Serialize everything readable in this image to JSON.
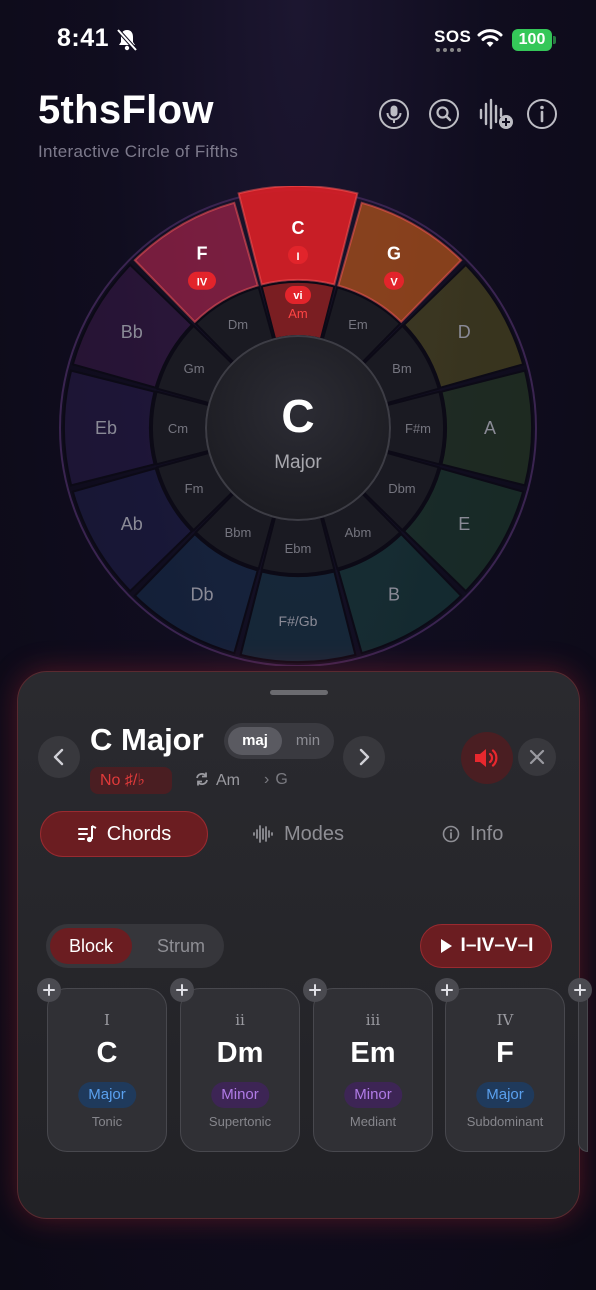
{
  "status": {
    "time": "8:41",
    "sos": "SOS",
    "battery": "100"
  },
  "header": {
    "title": "5thsFlow",
    "subtitle": "Interactive Circle of Fifths"
  },
  "wheel": {
    "center_key": "C",
    "center_mode": "Major",
    "major_keys": [
      "C",
      "G",
      "D",
      "A",
      "E",
      "B",
      "F#/Gb",
      "Db",
      "Ab",
      "Eb",
      "Bb",
      "F"
    ],
    "minor_keys": [
      "Am",
      "Em",
      "Bm",
      "F#m",
      "Dbm",
      "Abm",
      "Ebm",
      "Bbm",
      "Fm",
      "Cm",
      "Gm",
      "Dm"
    ],
    "numerals": {
      "C": "I",
      "G": "V",
      "F": "IV",
      "Am": "vi"
    },
    "segment_colors": [
      "#d21f26",
      "#b8561a",
      "#8f8a1f",
      "#3e6a2a",
      "#2a6a3a",
      "#1f6a55",
      "#1f5a66",
      "#1f4a70",
      "#2a2f6a",
      "#3a276a",
      "#5a2466",
      "#a3244a"
    ]
  },
  "panel": {
    "key_title": "C Major",
    "mode_major": "maj",
    "mode_minor": "min",
    "accidentals": "No ♯/♭",
    "relative": "Am",
    "next_key": "G",
    "tabs": {
      "chords": "Chords",
      "modes": "Modes",
      "info": "Info"
    },
    "playback": {
      "block": "Block",
      "strum": "Strum",
      "progression": "I–IV–V–I"
    },
    "chords": [
      {
        "roman": "I",
        "name": "C",
        "quality": "Major",
        "function": "Tonic"
      },
      {
        "roman": "ii",
        "name": "Dm",
        "quality": "Minor",
        "function": "Supertonic"
      },
      {
        "roman": "iii",
        "name": "Em",
        "quality": "Minor",
        "function": "Mediant"
      },
      {
        "roman": "IV",
        "name": "F",
        "quality": "Major",
        "function": "Subdominant"
      }
    ]
  },
  "icons": [
    "microphone-icon",
    "search-icon",
    "add-audio-icon",
    "info-icon",
    "speaker-icon",
    "close-icon"
  ]
}
